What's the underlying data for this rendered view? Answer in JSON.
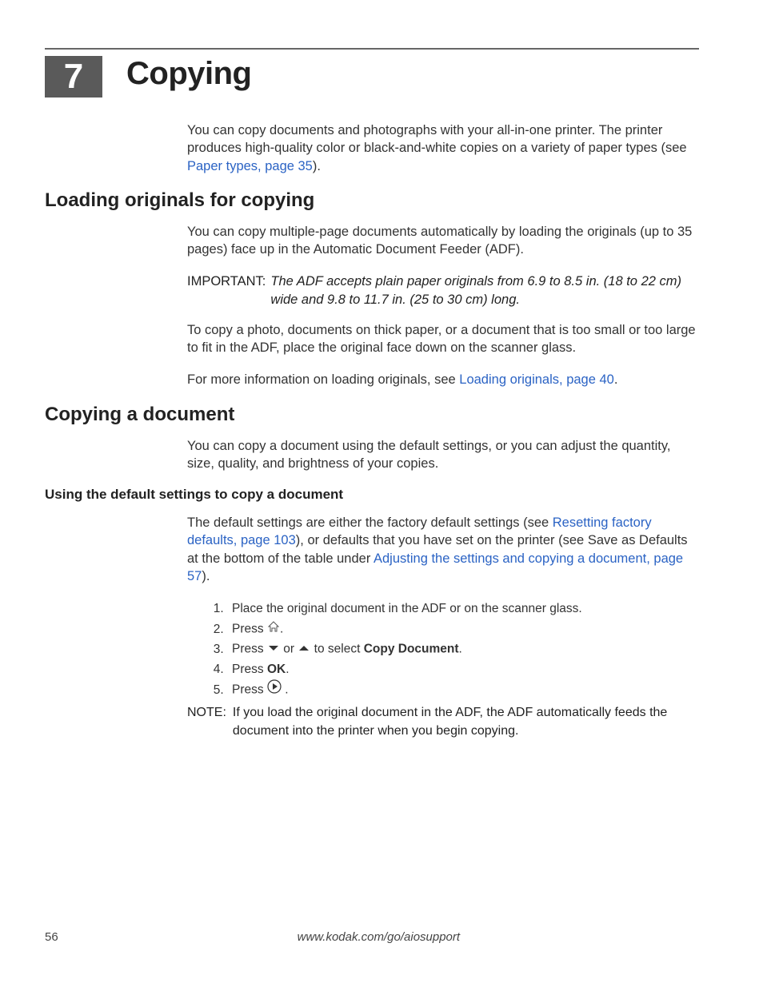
{
  "chapter": {
    "number": "7",
    "title": "Copying"
  },
  "intro": {
    "text_pre": "You can copy documents and photographs with your all-in-one printer. The printer produces high-quality color or black-and-white copies on a variety of paper types (see ",
    "link": "Paper types, page 35",
    "text_post": ")."
  },
  "section1": {
    "heading": "Loading originals for copying",
    "p1": "You can copy multiple-page documents automatically by loading the originals (up to 35 pages) face up in the Automatic Document Feeder (ADF).",
    "important_label": "IMPORTANT:",
    "important_text": "The ADF accepts plain paper originals from 6.9 to 8.5 in. (18 to 22 cm) wide and 9.8 to 11.7 in. (25 to 30 cm) long.",
    "p2": "To copy a photo, documents on thick paper, or a document that is too small or too large to fit in the ADF, place the original face down on the scanner glass.",
    "p3_pre": "For more information on loading originals, see ",
    "p3_link": "Loading originals, page 40",
    "p3_post": "."
  },
  "section2": {
    "heading": "Copying a document",
    "p1": "You can copy a document using the default settings, or you can adjust the quantity, size, quality, and brightness of your copies.",
    "sub_heading": "Using the default settings to copy a document",
    "p2_pre": "The default settings are either the factory default settings (see ",
    "p2_link1": "Resetting factory defaults, page 103",
    "p2_mid": "), or defaults that you have set on the printer (see Save as Defaults at the bottom of the table under ",
    "p2_link2": "Adjusting the settings and copying a document, page 57",
    "p2_post": ").",
    "steps": {
      "s1": "Place the original document in the ADF or on the scanner glass.",
      "s2_pre": "Press ",
      "s2_post": ".",
      "s3_pre": "Press ",
      "s3_mid": " or ",
      "s3_mid2": " to select ",
      "s3_bold": "Copy Document",
      "s3_post": ".",
      "s4_pre": "Press ",
      "s4_bold": "OK",
      "s4_post": ".",
      "s5_pre": "Press ",
      "s5_post": " ."
    },
    "note_label": "NOTE:",
    "note_text": "If you load the original document in the ADF, the ADF automatically feeds the document into the printer when you begin copying."
  },
  "footer": {
    "page": "56",
    "url": "www.kodak.com/go/aiosupport"
  }
}
